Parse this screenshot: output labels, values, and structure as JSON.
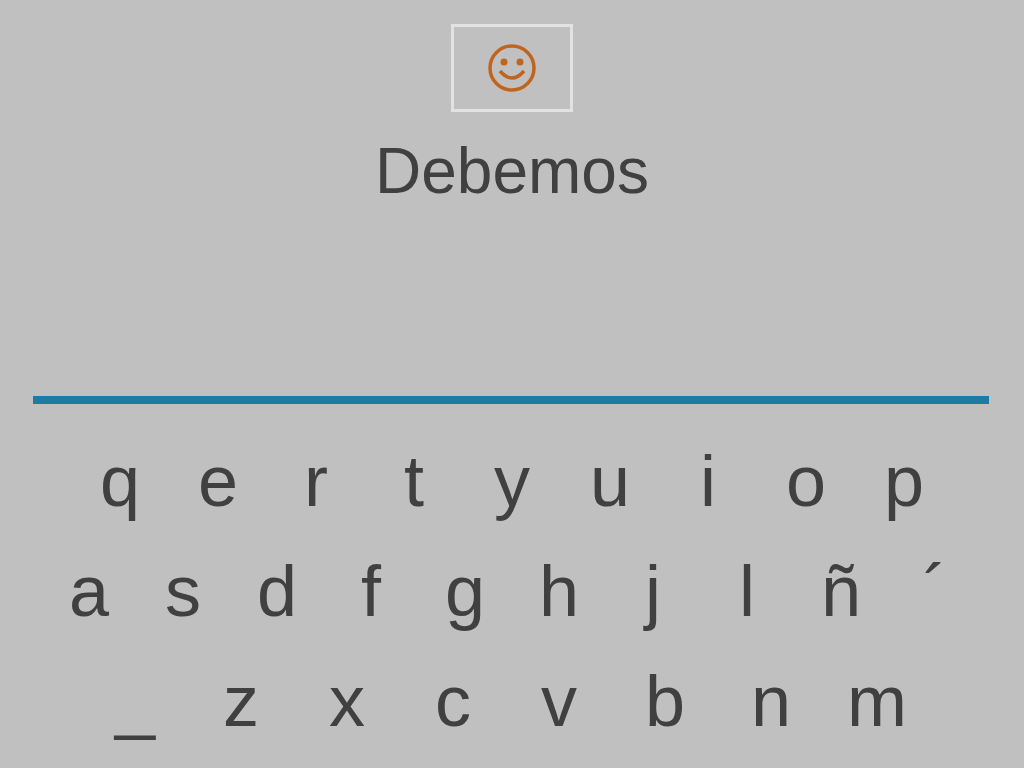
{
  "word": "Debemos",
  "keyboard_rows": [
    [
      "q",
      "e",
      "r",
      "t",
      "y",
      "u",
      "i",
      "o",
      "p"
    ],
    [
      "a",
      "s",
      "d",
      "f",
      "g",
      "h",
      "j",
      "l",
      "ñ",
      "´"
    ],
    [
      "_",
      "z",
      "x",
      "c",
      "v",
      "b",
      "n",
      "m"
    ]
  ]
}
